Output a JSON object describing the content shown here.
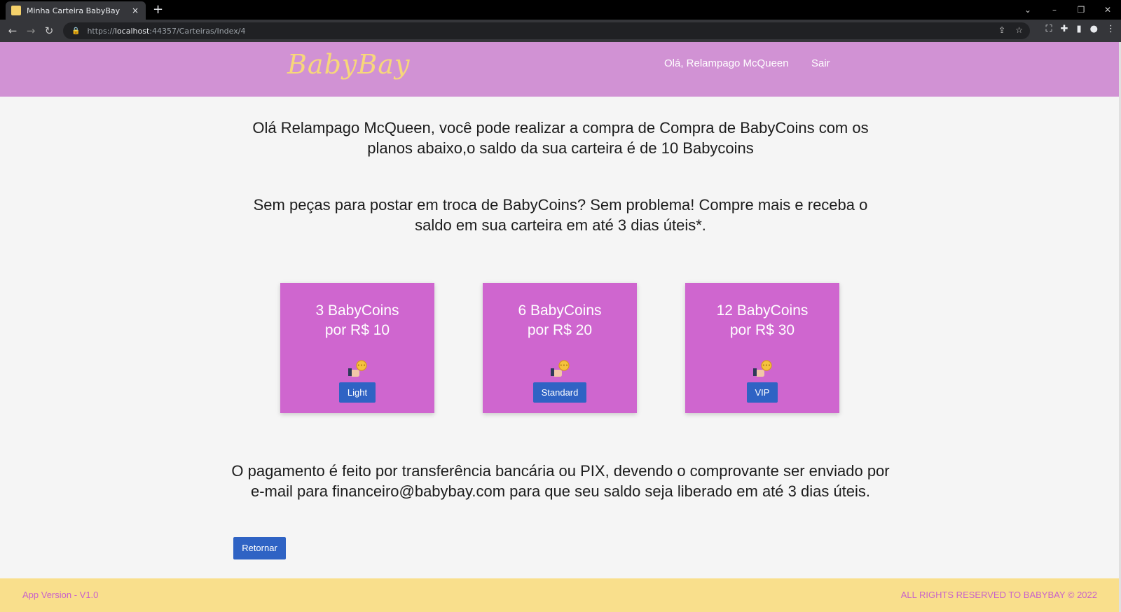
{
  "browser": {
    "tab_title": "Minha Carteira BabyBay",
    "tab_close": "×",
    "new_tab": "+",
    "url_scheme": "https://",
    "url_host": "localhost",
    "url_path": ":44357/Carteiras/Index/4"
  },
  "header": {
    "brand": "BabyBay",
    "greeting": "Olá, Relampago McQueen",
    "logout": "Sair"
  },
  "main": {
    "headline": "Olá Relampago McQueen, você pode realizar a compra de Compra de BabyCoins com os planos abaixo,o saldo da sua carteira é de 10 Babycoins",
    "subheadline": "Sem peças para postar em troca de BabyCoins? Sem problema! Compre mais e receba o saldo em sua carteira em até 3 dias úteis*.",
    "plans": [
      {
        "line1": "3 BabyCoins",
        "line2": "por R$ 10",
        "button": "Light"
      },
      {
        "line1": "6 BabyCoins",
        "line2": "por R$ 20",
        "button": "Standard"
      },
      {
        "line1": "12 BabyCoins",
        "line2": "por R$ 30",
        "button": "VIP"
      }
    ],
    "payment_text": "O pagamento é feito por transferência bancária ou PIX, devendo o comprovante ser enviado por e-mail para financeiro@babybay.com para que seu saldo seja liberado em até 3 dias úteis.",
    "return_button": "Retornar"
  },
  "footer": {
    "version": "App Version - V1.0",
    "rights": "ALL RIGHTS RESERVED TO BABYBAY © 2022"
  },
  "colors": {
    "navbar": "#d192d4",
    "brand": "#f7d77a",
    "card": "#cf66cf",
    "button": "#2f63c4",
    "footer": "#f9df8c",
    "footer_text": "#c963c9"
  },
  "icons": {
    "plan_icon": "coin-hand-icon"
  }
}
